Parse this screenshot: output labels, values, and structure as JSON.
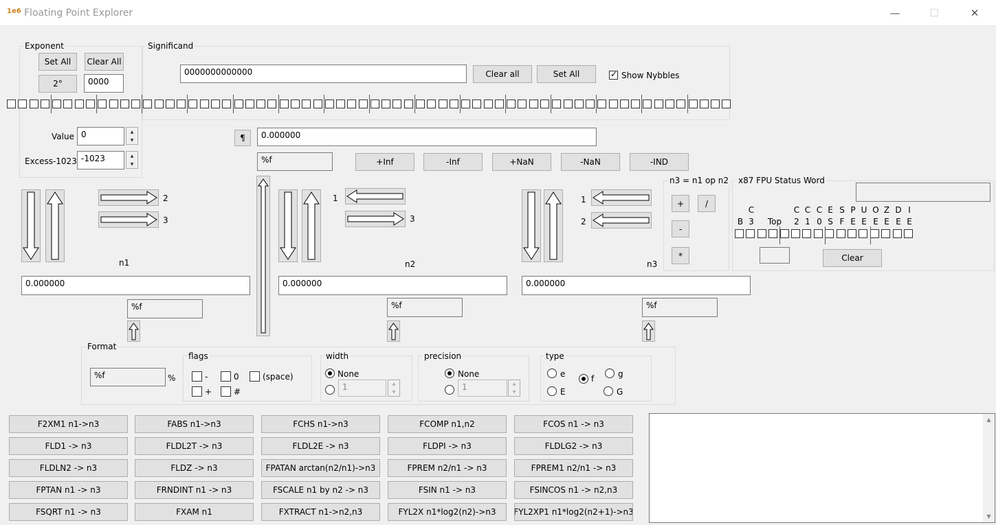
{
  "window": {
    "title": "Floating Point Explorer",
    "app_icon": "1e6"
  },
  "exponent": {
    "group_label": "Exponent",
    "set_all": "Set All",
    "clear_all": "Clear All",
    "pow_button": "2°",
    "hex_value": "0000",
    "value_label": "Value",
    "value": "0",
    "excess_label": "Excess-1023",
    "excess_value": "-1023"
  },
  "significand": {
    "group_label": "Significand",
    "hex_value": "0000000000000",
    "clear_all": "Clear all",
    "set_all": "Set All",
    "show_nybbles_label": "Show Nybbles",
    "show_nybbles": true
  },
  "value_display": {
    "pilcrow": "¶",
    "value": "0.000000",
    "format": "%f"
  },
  "specials": [
    "+Inf",
    "-Inf",
    "+NaN",
    "-NaN",
    "-IND"
  ],
  "n1": {
    "label": "n1",
    "value": "0.000000",
    "format": "%f",
    "to2": "2",
    "to3": "3"
  },
  "n2": {
    "label": "n2",
    "value": "0.000000",
    "format": "%f",
    "from1": "1",
    "to3": "3"
  },
  "n3": {
    "label": "n3",
    "value": "0.000000",
    "format": "%f",
    "from1": "1",
    "from2": "2"
  },
  "ops": {
    "group_label": "n3 = n1 op n2",
    "add": "+",
    "div": "/",
    "sub": "-",
    "mul": "*"
  },
  "fpu": {
    "group_label": "x87 FPU Status Word",
    "headers_top": [
      "",
      "C",
      "",
      "",
      "",
      "C",
      "C",
      "C",
      "E",
      "S",
      "P",
      "U",
      "O",
      "Z",
      "D",
      "I"
    ],
    "headers_bottom": [
      "B",
      "3",
      "",
      "Top",
      "",
      "2",
      "1",
      "0",
      "S",
      "F",
      "E",
      "E",
      "E",
      "E",
      "E",
      "E"
    ],
    "clear": "Clear"
  },
  "format": {
    "group_label": "Format",
    "value": "%f",
    "percent": "%",
    "flags_label": "flags",
    "flag_minus": "-",
    "flag_zero": "0",
    "flag_space": "(space)",
    "flag_plus": "+",
    "flag_hash": "#",
    "width_label": "width",
    "width_none": "None",
    "width_value": "1",
    "precision_label": "precision",
    "precision_none": "None",
    "precision_value": "1",
    "type_label": "type",
    "type_e": "e",
    "type_f": "f",
    "type_g": "g",
    "type_E": "E",
    "type_G": "G",
    "selected_type": "f"
  },
  "instructions": [
    [
      "F2XM1 n1->n3",
      "FABS n1->n3",
      "FCHS n1->n3",
      "FCOMP n1,n2",
      "FCOS n1 -> n3"
    ],
    [
      "FLD1 -> n3",
      "FLDL2T -> n3",
      "FLDL2E -> n3",
      "FLDPI -> n3",
      "FLDLG2 -> n3"
    ],
    [
      "FLDLN2 -> n3",
      "FLDZ -> n3",
      "FPATAN arctan(n2/n1)->n3",
      "FPREM n2/n1 -> n3",
      "FPREM1 n2/n1 -> n3"
    ],
    [
      "FPTAN n1 -> n3",
      "FRNDINT n1 -> n3",
      "FSCALE n1 by n2 -> n3",
      "FSIN n1 -> n3",
      "FSINCOS n1 -> n2,n3"
    ],
    [
      "FSQRT n1 -> n3",
      "FXAM n1",
      "FXTRACT n1->n2,n3",
      "FYL2X n1*log2(n2)->n3",
      "FYL2XP1 n1*log2(n2+1)->n3"
    ]
  ]
}
